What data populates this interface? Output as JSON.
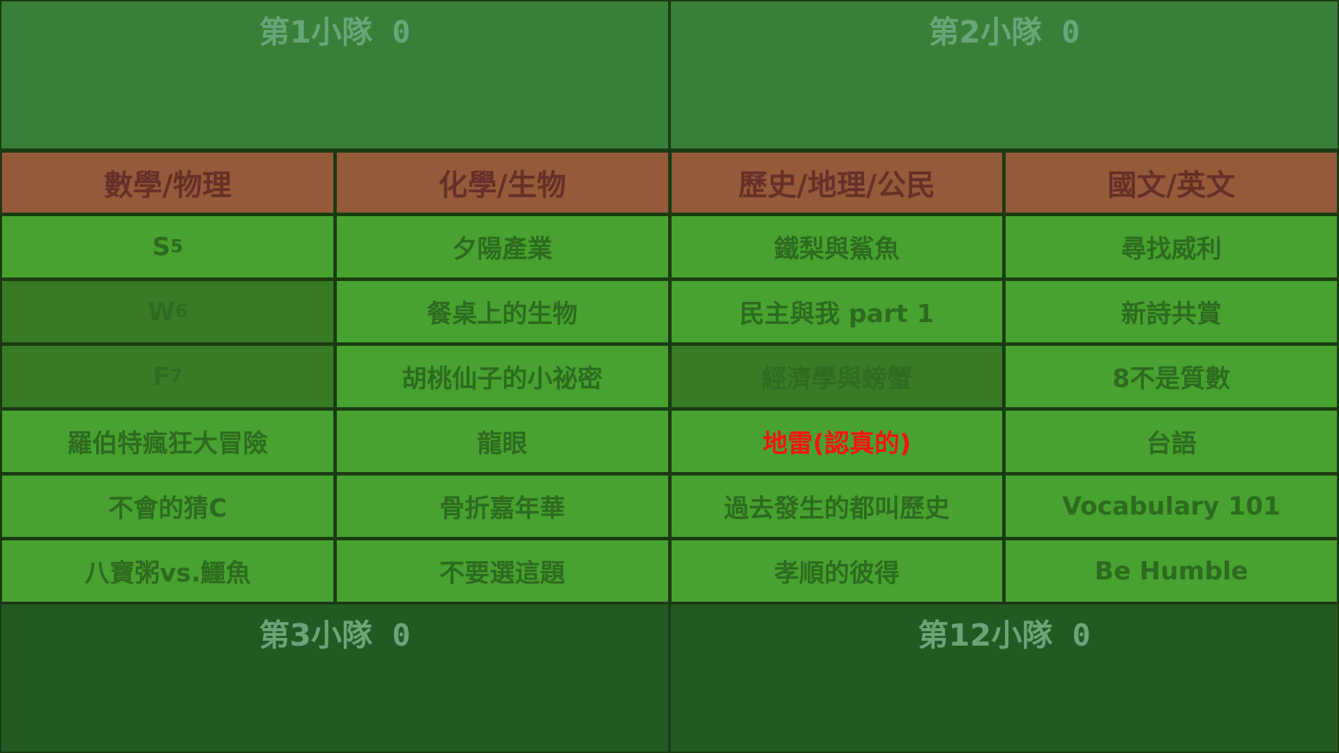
{
  "teams": [
    {
      "name": "第1小隊",
      "score": "0"
    },
    {
      "name": "第2小隊",
      "score": "0"
    },
    {
      "name": "第3小隊",
      "score": "0"
    },
    {
      "name": "第12小隊",
      "score": "0"
    }
  ],
  "categories": [
    "數學/物理",
    "化學/生物",
    "歷史/地理/公民",
    "國文/英文"
  ],
  "questions": [
    [
      {
        "base": "S",
        "sup": "5",
        "used": false
      },
      {
        "text": "夕陽產業"
      },
      {
        "text": "鐵梨與鯊魚"
      },
      {
        "text": "尋找威利"
      }
    ],
    [
      {
        "base": "W",
        "sup": "6",
        "used": true
      },
      {
        "text": "餐桌上的生物"
      },
      {
        "text": "民主與我 part 1"
      },
      {
        "text": "新詩共賞"
      }
    ],
    [
      {
        "base": "F",
        "sup": "7",
        "used": true
      },
      {
        "text": "胡桃仙子的小祕密"
      },
      {
        "text": "經濟學與螃蟹",
        "used": true
      },
      {
        "text": "8不是質數"
      }
    ],
    [
      {
        "text": "羅伯特瘋狂大冒險"
      },
      {
        "text": "龍眼"
      },
      {
        "text": "地雷(認真的)",
        "highlight": "#ff1010"
      },
      {
        "text": "台語"
      }
    ],
    [
      {
        "text": "不會的猜C"
      },
      {
        "text": "骨折嘉年華"
      },
      {
        "text": "過去發生的都叫歷史"
      },
      {
        "text": "Vocabulary 101"
      }
    ],
    [
      {
        "text": "八寶粥vs.鱷魚"
      },
      {
        "text": "不要選這題"
      },
      {
        "text": "孝順的彼得"
      },
      {
        "text": "Be Humble"
      }
    ]
  ]
}
